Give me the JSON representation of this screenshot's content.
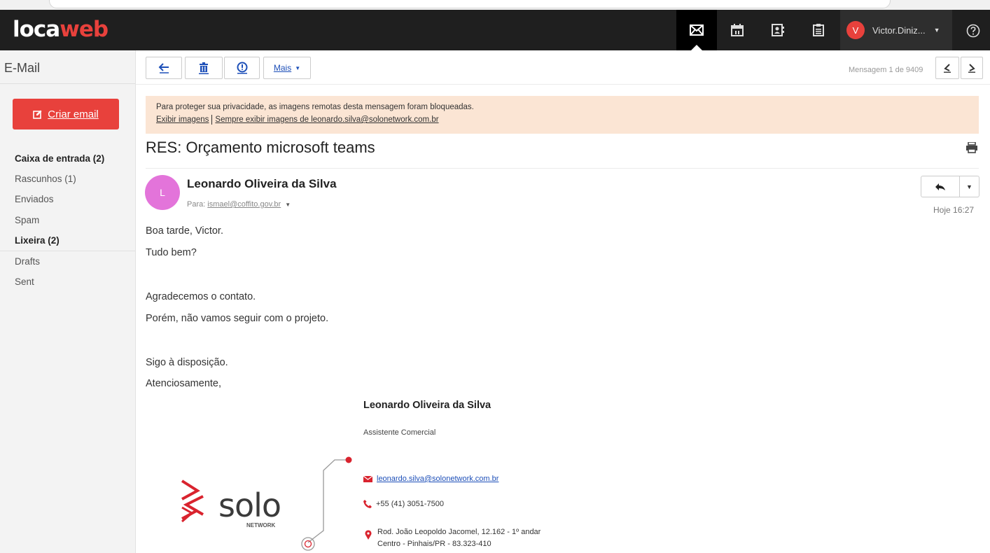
{
  "header": {
    "logo_main": "loca",
    "logo_accent": "web",
    "user_initial": "V",
    "user_name": "Victor.Diniz..."
  },
  "sidebar": {
    "title": "E-Mail",
    "compose_label": "Criar email",
    "folders": [
      {
        "label": "Caixa de entrada  (2)"
      },
      {
        "label": "Rascunhos  (1)"
      },
      {
        "label": "Enviados"
      },
      {
        "label": "Spam"
      },
      {
        "label": "Lixeira  (2)"
      },
      {
        "label": "Drafts"
      },
      {
        "label": "Sent"
      }
    ]
  },
  "toolbar": {
    "more_label": "Mais",
    "message_position": "Mensagem 1 de 9409"
  },
  "banner": {
    "notice": "Para proteger sua privacidade, as imagens remotas desta mensagem foram bloqueadas.",
    "show_images": "Exibir imagens",
    "always_show": "Sempre exibir imagens de leonardo.silva@solonetwork.com.br"
  },
  "message": {
    "subject": "RES: Orçamento microsoft teams",
    "sender_initial": "L",
    "sender_name": "Leonardo Oliveira da Silva",
    "to_label": "Para:",
    "to_address": "ismael@coffito.gov.br",
    "time": "Hoje 16:27",
    "body": [
      "Boa tarde, Victor.",
      "Tudo bem?",
      "Agradecemos o contato.",
      "Porém, não vamos seguir com o projeto.",
      "Sigo à disposição.",
      "Atenciosamente,"
    ]
  },
  "signature": {
    "name": "Leonardo Oliveira da Silva",
    "role": "Assistente Comercial",
    "email": "leonardo.silva@solonetwork.com.br",
    "phone": "+55 (41) 3051-7500",
    "address_line1": "Rod. João Leopoldo Jacomel, 12.162 - 1º andar",
    "address_line2": "Centro - Pinhais/PR - 83.323-410",
    "logo_text": "solo",
    "logo_subtext": "NETWORK"
  },
  "colors": {
    "brand_red": "#e8413c",
    "banner_bg": "#fbe5d4",
    "sender_avatar": "#e374da",
    "link_blue": "#1d4fb8"
  }
}
